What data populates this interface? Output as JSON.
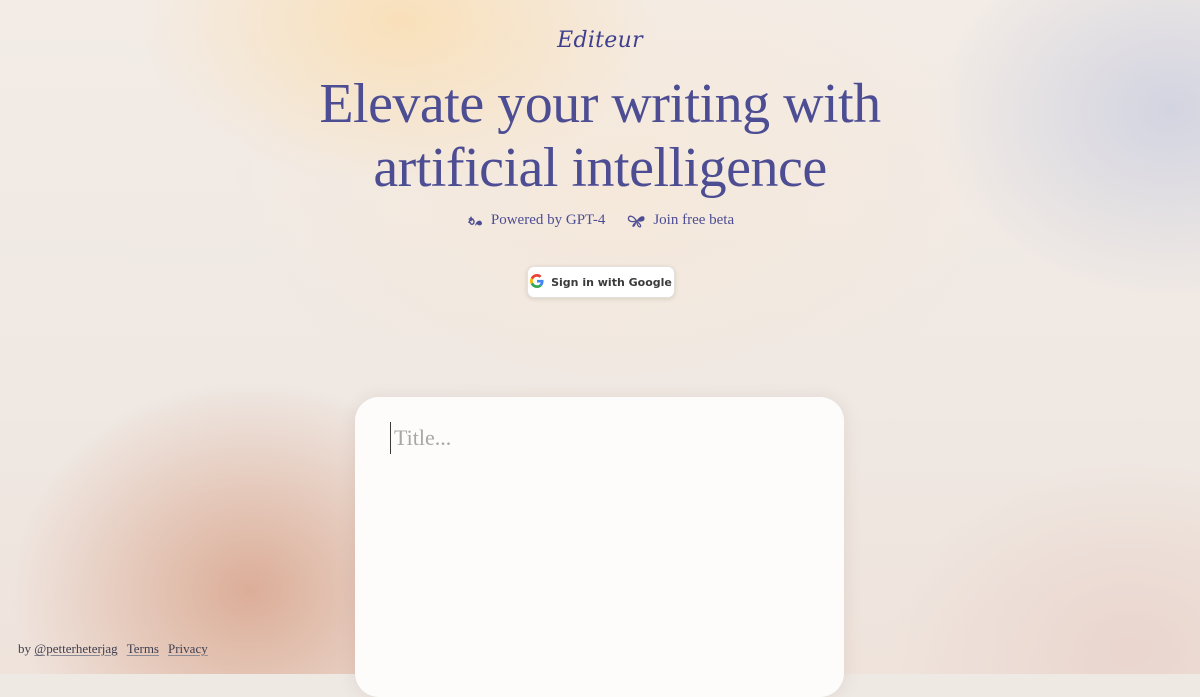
{
  "brand": {
    "logo_text": "Editeur"
  },
  "hero": {
    "headline_line1": "Elevate your writing with",
    "headline_line2": "artificial intelligence"
  },
  "features": [
    {
      "icon": "sparkle-swirl-icon",
      "label": "Powered by GPT-4"
    },
    {
      "icon": "butterfly-icon",
      "label": "Join free beta"
    }
  ],
  "auth": {
    "signin_label": "Sign in with Google",
    "icon": "google-icon"
  },
  "editor": {
    "title_placeholder": "Title..."
  },
  "footer": {
    "by_prefix": "by",
    "author_handle": "@petterheterjag",
    "terms_label": "Terms",
    "privacy_label": "Privacy"
  },
  "colors": {
    "accent": "#4d4d94",
    "editor_bg": "#fdfcfb",
    "placeholder": "#a9a7a6"
  }
}
